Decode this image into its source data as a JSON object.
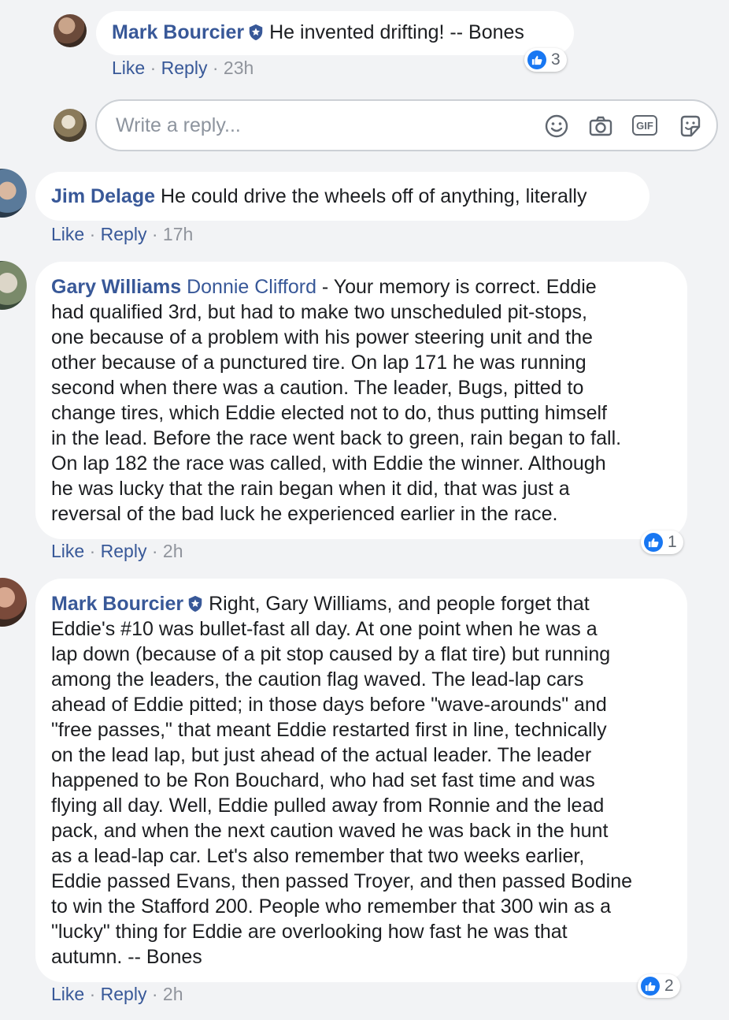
{
  "comments": [
    {
      "author": "Mark Bourcier",
      "text": "He invented drifting! -- Bones",
      "like_label": "Like",
      "reply_label": "Reply",
      "time": "23h",
      "reaction_count": "3"
    },
    {
      "author": "Jim Delage",
      "text": "He could drive the wheels off of anything, literally",
      "like_label": "Like",
      "reply_label": "Reply",
      "time": "17h"
    },
    {
      "author": "Gary Williams",
      "mention": "Donnie Clifford",
      "text_lines": [
        " - Your memory is correct. Eddie",
        "had qualified 3rd, but had to make two unscheduled pit-stops,",
        "one because of a problem with his power steering unit and the",
        "other because of a punctured tire. On lap 171 he was running",
        "second when there was a caution. The leader, Bugs, pitted to",
        "change tires, which Eddie elected not to do, thus putting himself",
        "in the lead. Before the race went back to green, rain began to fall.",
        "On lap 182 the race was called, with Eddie the winner. Although",
        "he was lucky that the rain began when it did, that was just a",
        "reversal of the bad luck he experienced earlier in the race."
      ],
      "like_label": "Like",
      "reply_label": "Reply",
      "time": "2h",
      "reaction_count": "1"
    },
    {
      "author": "Mark Bourcier",
      "text_lines": [
        "Right, Gary Williams, and people forget that",
        "Eddie's #10 was bullet-fast all day. At one point when he was a",
        "lap down (because of a pit stop caused by a flat tire) but running",
        "among the leaders, the caution flag waved. The lead-lap cars",
        "ahead of Eddie pitted; in those days before \"wave-arounds\" and",
        "\"free passes,\" that meant Eddie restarted first in line, technically",
        "on the lead lap, but just ahead of the actual leader. The leader",
        "happened to be Ron Bouchard, who had set fast time and was",
        "flying all day. Well, Eddie pulled away from Ronnie and the lead",
        "pack, and when the next caution waved he was back in the hunt",
        "as a lead-lap car. Let's also remember that two weeks earlier,",
        "Eddie passed Evans, then passed Troyer, and then passed Bodine",
        "to win the Stafford 200. People who remember that 300 win as a",
        "\"lucky\" thing for Eddie are overlooking how fast he was that",
        "autumn. -- Bones"
      ],
      "like_label": "Like",
      "reply_label": "Reply",
      "time": "2h",
      "reaction_count": "2"
    }
  ],
  "reply_box": {
    "placeholder": "Write a reply..."
  },
  "reply_tools": {
    "gif_label": "GIF"
  },
  "icons": {
    "verified": "shield-badge-icon",
    "reaction": "thumbs-up-icon",
    "emoji": "smiley-icon",
    "camera": "camera-icon",
    "gif": "gif-icon",
    "sticker": "sticker-icon"
  },
  "colors": {
    "link": "#385898",
    "like_blue": "#1877f2",
    "meta_gray": "#90949c",
    "background": "#f2f3f5"
  }
}
